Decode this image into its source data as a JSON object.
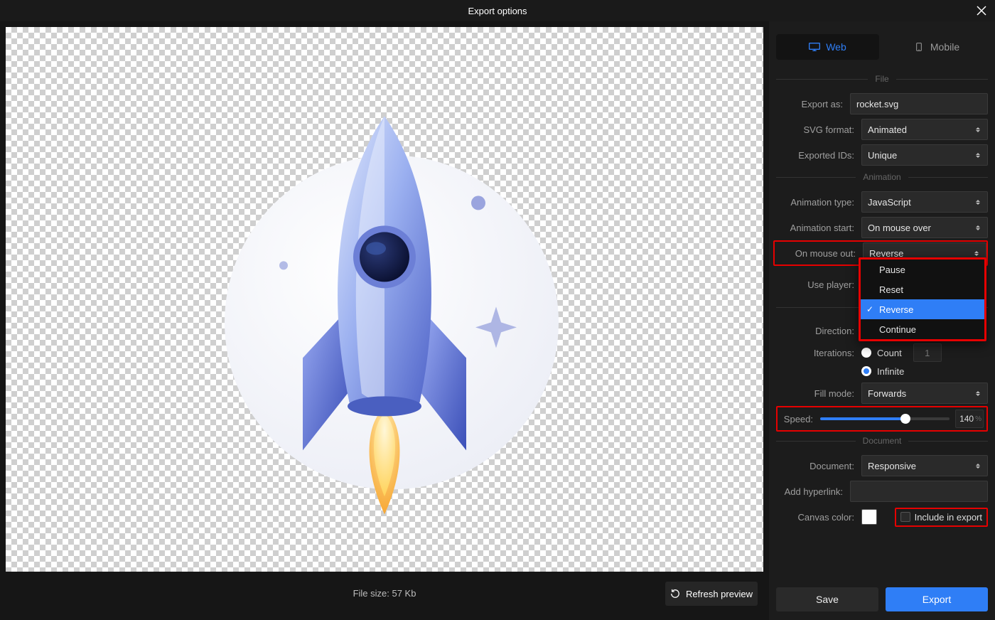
{
  "title": "Export options",
  "tabs": {
    "web": "Web",
    "mobile": "Mobile"
  },
  "sections": {
    "file": "File",
    "animation": "Animation",
    "document": "Document"
  },
  "file": {
    "exportAsLabel": "Export as:",
    "exportAsValue": "rocket.svg",
    "svgFormatLabel": "SVG format:",
    "svgFormatValue": "Animated",
    "exportedIdsLabel": "Exported IDs:",
    "exportedIdsValue": "Unique"
  },
  "animation": {
    "typeLabel": "Animation type:",
    "typeValue": "JavaScript",
    "startLabel": "Animation start:",
    "startValue": "On mouse over",
    "mouseOutLabel": "On mouse out:",
    "mouseOutValue": "Reverse",
    "mouseOutOptions": [
      "Pause",
      "Reset",
      "Reverse",
      "Continue"
    ],
    "usePlayerLabel": "Use player:",
    "directionLabel": "Direction:",
    "iterationsLabel": "Iterations:",
    "countLabel": "Count",
    "countValue": "1",
    "infiniteLabel": "Infinite",
    "infiniteSelected": true,
    "fillModeLabel": "Fill mode:",
    "fillModeValue": "Forwards",
    "speedLabel": "Speed:",
    "speedValue": "140",
    "speedPercent": 66
  },
  "document": {
    "documentLabel": "Document:",
    "documentValue": "Responsive",
    "hyperlinkLabel": "Add hyperlink:",
    "hyperlinkValue": "",
    "canvasColorLabel": "Canvas color:",
    "canvasColor": "#ffffff",
    "includeLabel": "Include in export"
  },
  "preview": {
    "fileSize": "File size: 57 Kb",
    "refreshLabel": "Refresh preview"
  },
  "footer": {
    "save": "Save",
    "export": "Export"
  }
}
